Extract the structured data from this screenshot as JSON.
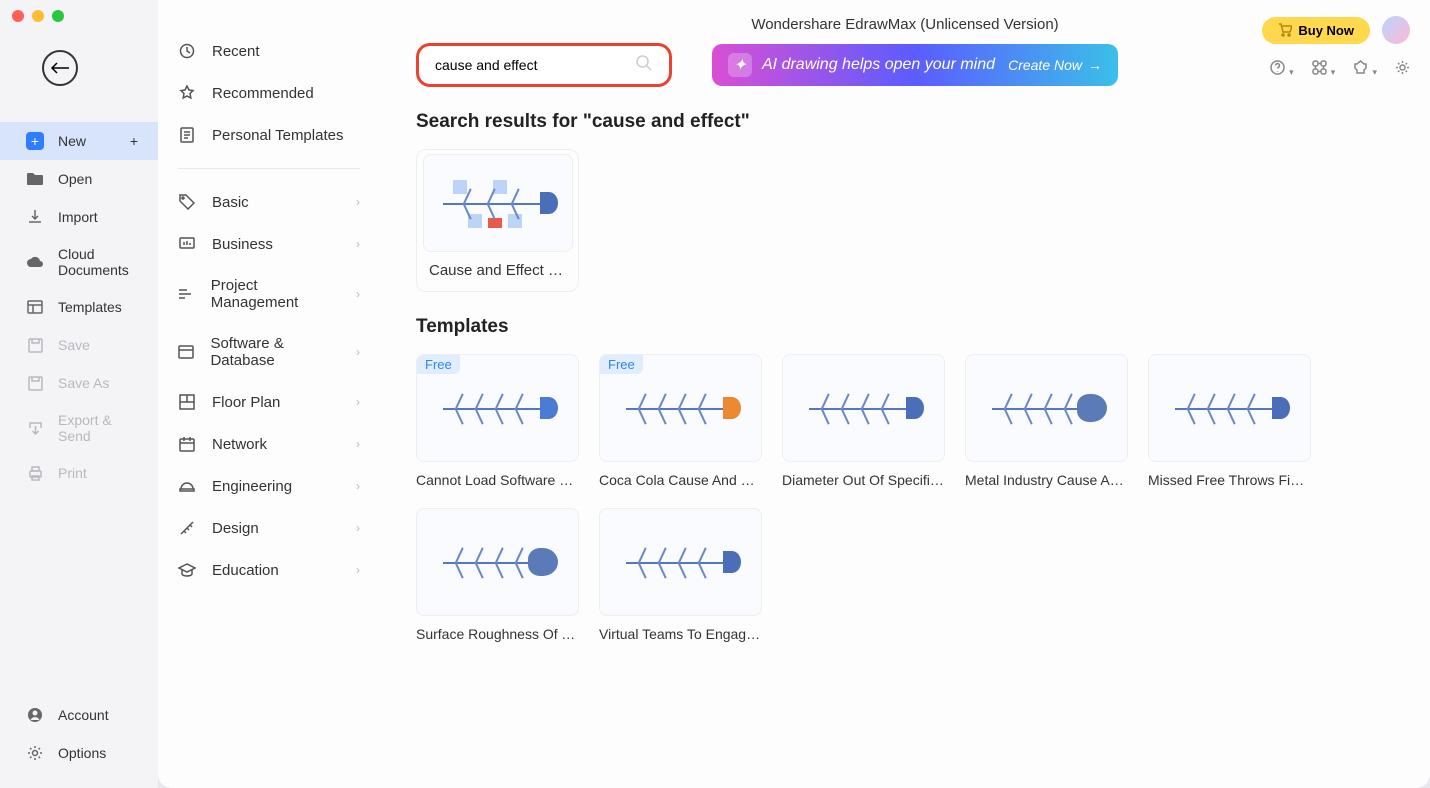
{
  "window": {
    "title": "Wondershare EdrawMax (Unlicensed Version)"
  },
  "topRight": {
    "buy": "Buy Now"
  },
  "leftNav": {
    "new": "New",
    "open": "Open",
    "import": "Import",
    "cloud": "Cloud Documents",
    "templates": "Templates",
    "save": "Save",
    "saveAs": "Save As",
    "export": "Export & Send",
    "print": "Print",
    "account": "Account",
    "options": "Options"
  },
  "cats": {
    "recent": "Recent",
    "recommended": "Recommended",
    "personal": "Personal Templates",
    "basic": "Basic",
    "business": "Business",
    "project": "Project Management",
    "software": "Software & Database",
    "floor": "Floor Plan",
    "network": "Network",
    "engineering": "Engineering",
    "design": "Design",
    "education": "Education"
  },
  "search": {
    "value": "cause and effect"
  },
  "aiBanner": {
    "text": "AI drawing helps open your mind",
    "cta": "Create Now"
  },
  "results": {
    "heading": "Search results for \"cause and effect\"",
    "items": [
      {
        "label": "Cause and Effect Di…"
      }
    ]
  },
  "templates": {
    "heading": "Templates",
    "freeTag": "Free",
    "items": [
      {
        "label": "Cannot Load Software On…",
        "free": true
      },
      {
        "label": "Coca Cola Cause And Effect",
        "free": true
      },
      {
        "label": "Diameter Out Of Specifica…"
      },
      {
        "label": "Metal Industry Cause And…"
      },
      {
        "label": "Missed Free Throws Fish…"
      },
      {
        "label": "Surface Roughness Of Th…"
      },
      {
        "label": "Virtual Teams To Engage …"
      }
    ]
  }
}
